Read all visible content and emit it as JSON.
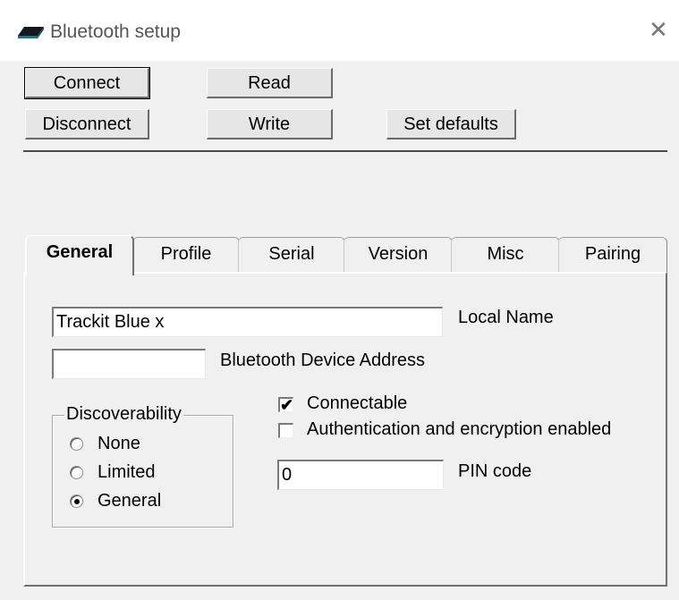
{
  "window": {
    "title": "Bluetooth setup",
    "close_glyph": "✕"
  },
  "toolbar": {
    "connect": "Connect",
    "read": "Read",
    "disconnect": "Disconnect",
    "write": "Write",
    "set_defaults": "Set defaults"
  },
  "tabs": [
    "General",
    "Profile",
    "Serial",
    "Version",
    "Misc",
    "Pairing"
  ],
  "active_tab": "General",
  "general": {
    "local_name_value": "Trackit Blue x",
    "local_name_label": "Local Name",
    "address_value": "",
    "address_label": "Bluetooth Device Address",
    "discoverability": {
      "legend": "Discoverability",
      "options": [
        "None",
        "Limited",
        "General"
      ],
      "selected": "General"
    },
    "connectable": {
      "label": "Connectable",
      "checked": true
    },
    "auth": {
      "label": "Authentication and encryption enabled",
      "checked": false
    },
    "pin_value": "0",
    "pin_label": "PIN code"
  },
  "icons": {
    "app": "bluetooth-device-icon",
    "close": "close-icon",
    "check": "✔"
  }
}
